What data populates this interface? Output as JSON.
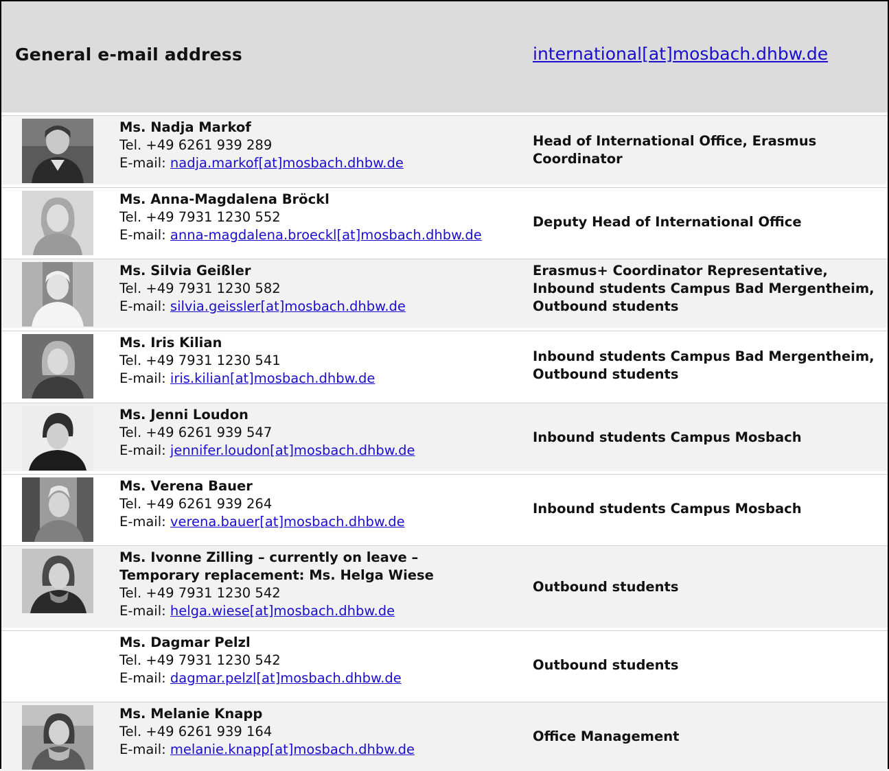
{
  "header": {
    "label": "General e-mail address",
    "email": "international[at]mosbach.dhbw.de"
  },
  "people": [
    {
      "name": "Ms. Nadja Markof",
      "phone": "Tel. +49 6261 939 289",
      "email_label": "E-mail: ",
      "email": "nadja.markof[at]mosbach.dhbw.de",
      "role": "Head of International Office, Erasmus Coordinator"
    },
    {
      "name": "Ms. Anna-Magdalena Bröckl",
      "phone": "Tel. +49 7931 1230 552",
      "email_label": "E-mail: ",
      "email": "anna-magdalena.broeckl[at]mosbach.dhbw.de",
      "role": "Deputy Head of International Office"
    },
    {
      "name": "Ms. Silvia Geißler",
      "phone": "Tel. +49 7931 1230 582",
      "email_label": "E-mail: ",
      "email": "silvia.geissler[at]mosbach.dhbw.de",
      "role": "Erasmus+ Coordinator Representative, Inbound students Campus Bad Mergentheim, Outbound students"
    },
    {
      "name": "Ms. Iris Kilian",
      "phone": "Tel. +49 7931 1230 541",
      "email_label": "E-mail: ",
      "email": "iris.kilian[at]mosbach.dhbw.de",
      "role": "Inbound students Campus Bad Mergentheim, Outbound students"
    },
    {
      "name": "Ms. Jenni Loudon",
      "phone": "Tel. +49 6261 939 547",
      "email_label": "E-mail: ",
      "email": "jennifer.loudon[at]mosbach.dhbw.de",
      "role": "Inbound students Campus Mosbach"
    },
    {
      "name": "Ms. Verena Bauer",
      "phone": "Tel. +49 6261 939 264",
      "email_label": "E-mail: ",
      "email": "verena.bauer[at]mosbach.dhbw.de",
      "role": "Inbound students Campus Mosbach"
    },
    {
      "name": "Ms. Ivonne Zilling – currently on leave –",
      "name2": "Temporary replacement: Ms. Helga Wiese",
      "phone": "Tel. +49 7931 1230 542",
      "email_label": "E-mail: ",
      "email": "helga.wiese[at]mosbach.dhbw.de",
      "role": "Outbound students"
    },
    {
      "name": "Ms. Dagmar Pelzl",
      "phone": "Tel. +49 7931 1230 542",
      "email_label": "E-mail: ",
      "email": "dagmar.pelzl[at]mosbach.dhbw.de",
      "role": "Outbound students"
    },
    {
      "name": "Ms. Melanie Knapp",
      "phone": "Tel. +49 6261 939 164",
      "email_label": "E-mail: ",
      "email": "melanie.knapp[at]mosbach.dhbw.de",
      "role": "Office Management"
    }
  ]
}
